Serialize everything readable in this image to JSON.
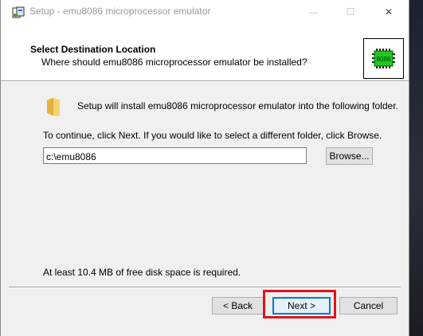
{
  "window": {
    "title": "Setup - emu8086 microprocessor emulator",
    "controls": {
      "minimize": "—",
      "maximize": "☐",
      "close": "✕"
    }
  },
  "header": {
    "title": "Select Destination Location",
    "subtitle": "Where should emu8086 microprocessor emulator be installed?",
    "chip_label": "8086"
  },
  "body": {
    "install_text": "Setup will install emu8086 microprocessor emulator into the following folder.",
    "continue_text": "To continue, click Next. If you would like to select a different folder, click Browse.",
    "path_value": "c:\\emu8086",
    "browse_label": "Browse...",
    "disk_space_text": "At least 10.4 MB of free disk space is required."
  },
  "footer": {
    "back_label": "< Back",
    "next_label": "Next >",
    "cancel_label": "Cancel"
  },
  "colors": {
    "highlight": "#e0141b",
    "focus_border": "#0078d7",
    "chip_green": "#1ec81e"
  },
  "icons": [
    "setup-app-icon",
    "chip-icon",
    "folder-icon"
  ]
}
